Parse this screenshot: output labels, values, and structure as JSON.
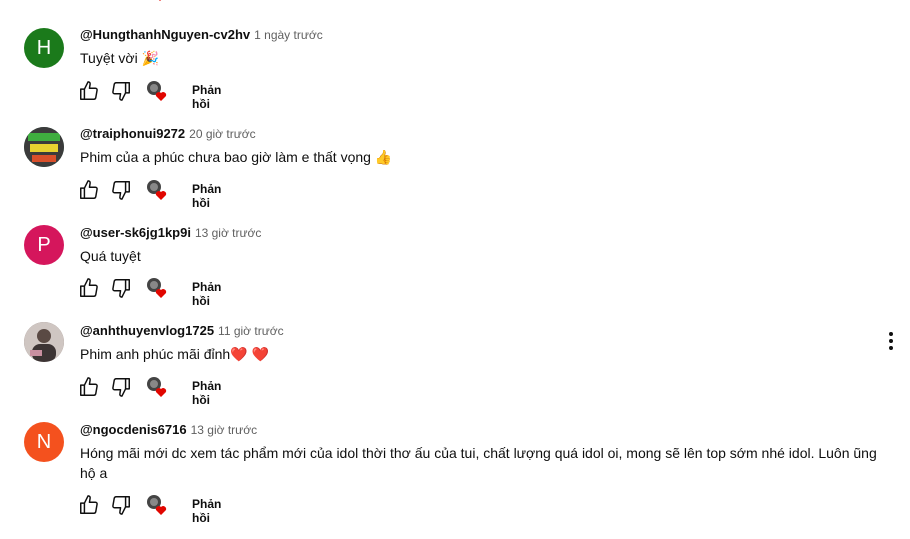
{
  "comments": [
    {
      "author": "@HungthanhNguyen-cv2hv",
      "time": "1 ngày trước",
      "text": "Tuyệt vời 🎉",
      "avatar_letter": "H",
      "avatar_color": "#1b7a1b",
      "reply_label": "Phản hồi"
    },
    {
      "author": "@traiphonui9272",
      "time": "20 giờ trước",
      "text": "Phim của a phúc chưa bao giờ làm e thất vọng 👍",
      "avatar_letter": "",
      "avatar_color": "#2d6a4f",
      "reply_label": "Phản hồi"
    },
    {
      "author": "@user-sk6jg1kp9i",
      "time": "13 giờ trước",
      "text": "Quá tuyệt",
      "avatar_letter": "P",
      "avatar_color": "#d5165c",
      "reply_label": "Phản hồi"
    },
    {
      "author": "@anhthuyenvlog1725",
      "time": "11 giờ trước",
      "text": "Phim anh phúc mãi đỉnh❤️ ❤️",
      "avatar_letter": "",
      "avatar_color": "#7a6a66",
      "reply_label": "Phản hồi"
    },
    {
      "author": "@ngocdenis6716",
      "time": "13 giờ trước",
      "text": "Hóng mãi mới dc xem tác phẩm mới của idol thời thơ ấu của tui, chất lượng quá idol oi, mong sẽ lên top sớm nhé idol. Luôn ũng hộ a",
      "avatar_letter": "N",
      "avatar_color": "#f4511e",
      "reply_label": "Phản hồi"
    }
  ],
  "colors": {
    "heart": "#e10600",
    "meta": "#606060"
  },
  "icons": {
    "like": "thumbs-up-icon",
    "dislike": "thumbs-down-icon",
    "creator_heart": "creator-heart-icon",
    "menu": "more-vert-icon"
  }
}
